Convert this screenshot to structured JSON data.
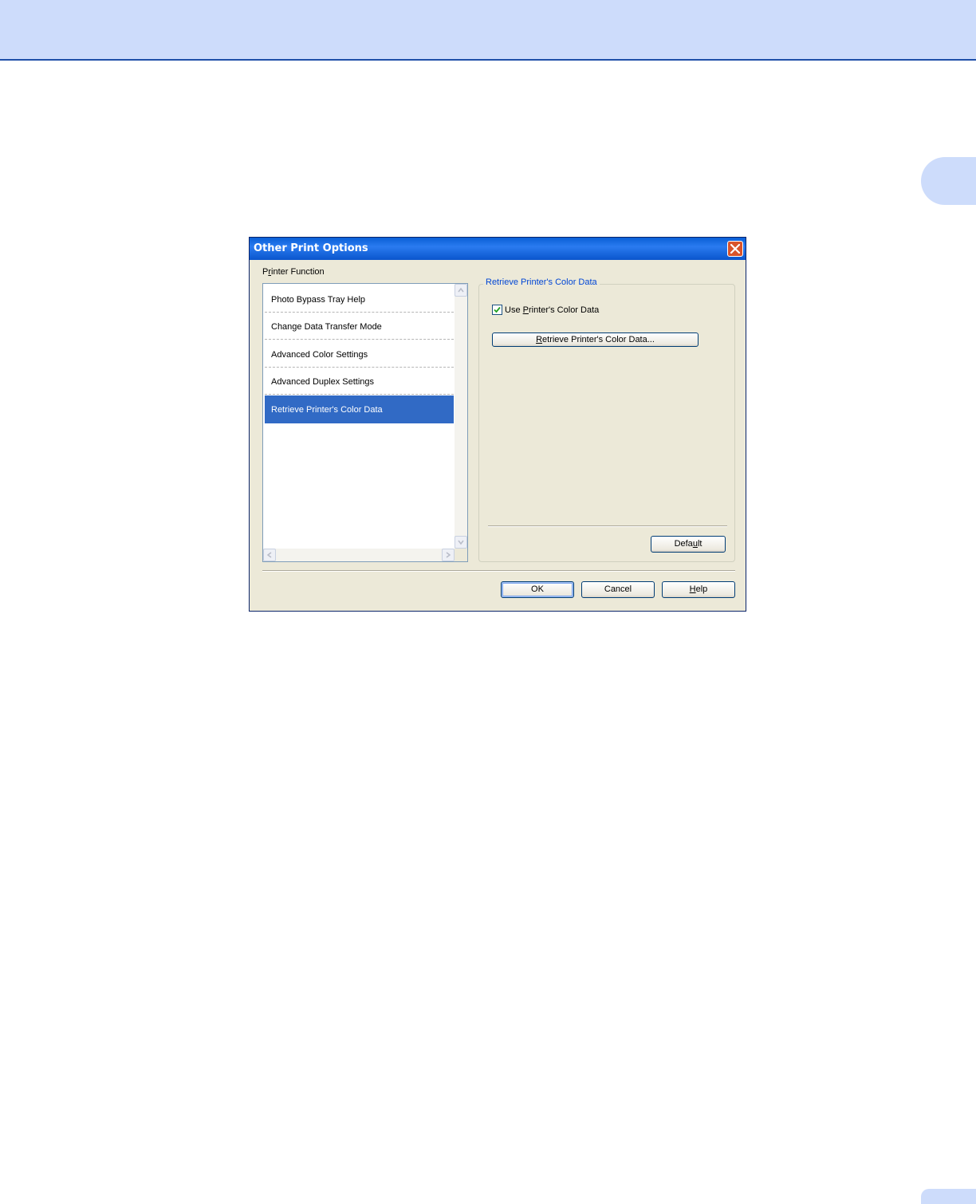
{
  "dialog": {
    "title": "Other Print Options",
    "list_label_prefix": "P",
    "list_label_mnemonic": "r",
    "list_label_rest": "inter Function",
    "list_items": [
      {
        "label": "Photo Bypass Tray Help"
      },
      {
        "label": "Change Data Transfer Mode"
      },
      {
        "label": "Advanced Color Settings"
      },
      {
        "label": "Advanced Duplex Settings"
      },
      {
        "label": "Retrieve Printer's Color Data",
        "selected": true
      }
    ],
    "group_title": "Retrieve Printer's Color Data",
    "checkbox": {
      "label_prefix": "Use ",
      "label_mnemonic": "P",
      "label_rest": "rinter's Color Data",
      "checked": true
    },
    "retrieve_button": {
      "mnemonic": "R",
      "rest": "etrieve Printer's Color Data..."
    },
    "default_button": {
      "prefix": "Defa",
      "mnemonic": "u",
      "rest": "lt"
    },
    "ok_label": "OK",
    "cancel_label": "Cancel",
    "help_button": {
      "mnemonic": "H",
      "rest": "elp"
    }
  },
  "icons": {
    "close": "close-icon",
    "check": "checkmark-icon",
    "scroll_up": "chevron-up-icon",
    "scroll_down": "chevron-down-icon",
    "scroll_left": "chevron-left-icon",
    "scroll_right": "chevron-right-icon"
  },
  "colors": {
    "accent_band": "#cddcfb",
    "selection": "#316ac5",
    "group_title": "#0046d5"
  }
}
